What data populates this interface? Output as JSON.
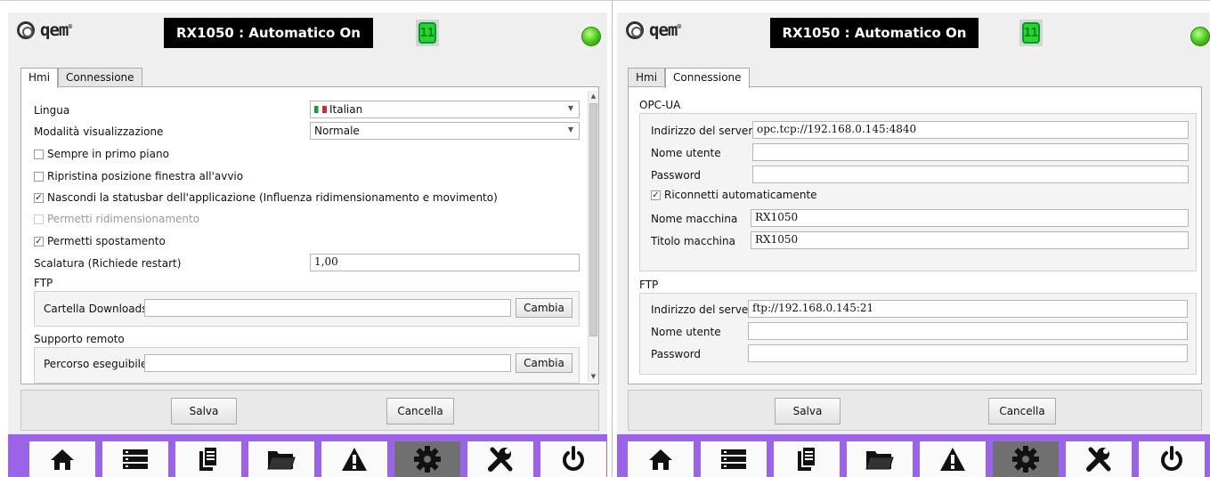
{
  "brand": {
    "logo_text": "qem",
    "trademark": "®"
  },
  "header": {
    "title": "RX1050 : Automatico On",
    "badge": "11",
    "status_color": "#44c414"
  },
  "tabs": [
    "Hmi",
    "Connessione"
  ],
  "left": {
    "lingua_label": "Lingua",
    "lingua_value": "Italian",
    "modalita_label": "Modalità visualizzazione",
    "modalita_value": "Normale",
    "sempre_primo_piano": {
      "label": "Sempre in primo piano",
      "checked": false
    },
    "ripristina_posizione": {
      "label": "Ripristina posizione finestra all'avvio",
      "checked": false
    },
    "nascondi_statusbar": {
      "label": "Nascondi la statusbar dell'applicazione (Influenza  ridimensionamento e movimento)",
      "checked": true
    },
    "permetti_ridimensionamento": {
      "label": "Permetti ridimensionamento",
      "checked": false,
      "disabled": true
    },
    "permetti_spostamento": {
      "label": "Permetti spostamento",
      "checked": true
    },
    "scalatura_label": "Scalatura (Richiede restart)",
    "scalatura_value": "1,00",
    "ftp_title": "FTP",
    "cartella_label": "Cartella Downloads",
    "cartella_value": "",
    "cambia_label": "Cambia",
    "supporto_title": "Supporto remoto",
    "percorso_label": "Percorso eseguibile",
    "percorso_value": ""
  },
  "right": {
    "opcua_title": "OPC-UA",
    "opc_server_label": "Indirizzo del server",
    "opc_server_value": "opc.tcp://192.168.0.145:4840",
    "opc_user_label": "Nome utente",
    "opc_user_value": "",
    "opc_password_label": "Password",
    "opc_password_value": "",
    "riconnetti": {
      "label": "Riconnetti automaticamente",
      "checked": true
    },
    "nome_macchina_label": "Nome macchina",
    "nome_macchina_value": "RX1050",
    "titolo_macchina_label": "Titolo macchina",
    "titolo_macchina_value": "RX1050",
    "ftp_title": "FTP",
    "ftp_server_label": "Indirizzo del server",
    "ftp_server_value": "ftp://192.168.0.145:21",
    "ftp_user_label": "Nome utente",
    "ftp_user_value": "",
    "ftp_password_label": "Password",
    "ftp_password_value": ""
  },
  "actions": {
    "save": "Salva",
    "cancel": "Cancella"
  },
  "nav": {
    "items": [
      "home-icon",
      "list-icon",
      "documents-icon",
      "folder-icon",
      "warning-icon",
      "settings-gear-icon",
      "tools-icon",
      "power-icon"
    ],
    "active": "settings-gear-icon",
    "accent": "#9a63e8"
  }
}
